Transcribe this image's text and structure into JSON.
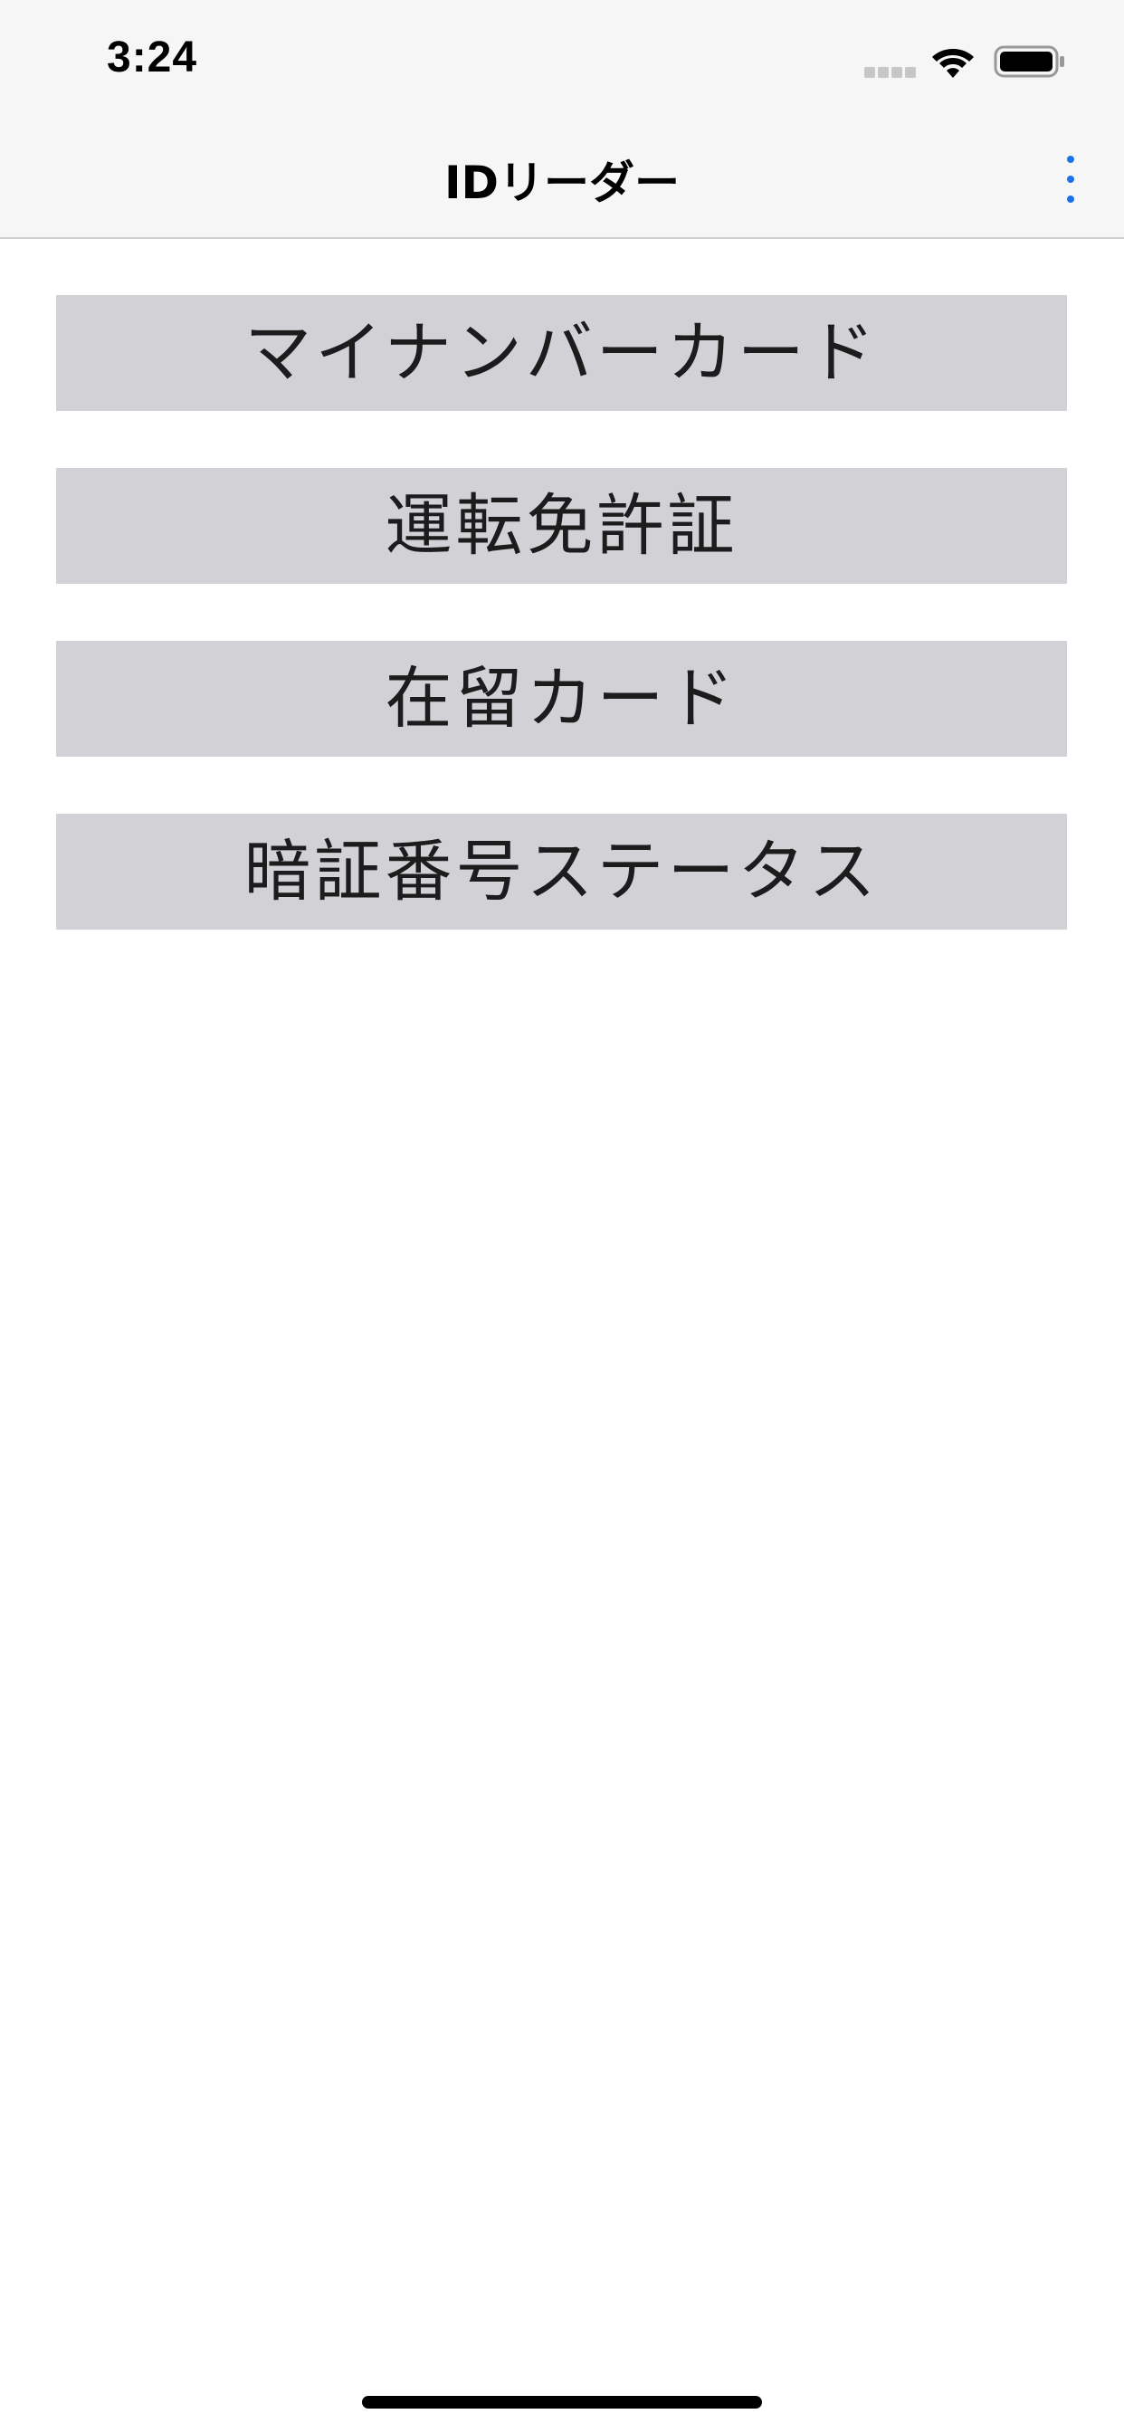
{
  "status_bar": {
    "time": "3:24",
    "icons": [
      "signal-icon",
      "wifi-icon",
      "battery-icon"
    ]
  },
  "nav": {
    "title": "IDリーダー",
    "more_icon": "more-vertical-icon",
    "accent_color": "#1a73e8"
  },
  "menu": {
    "items": [
      {
        "label": "マイナンバーカード"
      },
      {
        "label": "運転免許証"
      },
      {
        "label": "在留カード"
      },
      {
        "label": "暗証番号ステータス"
      }
    ],
    "button_color": "#d2d2d6"
  }
}
